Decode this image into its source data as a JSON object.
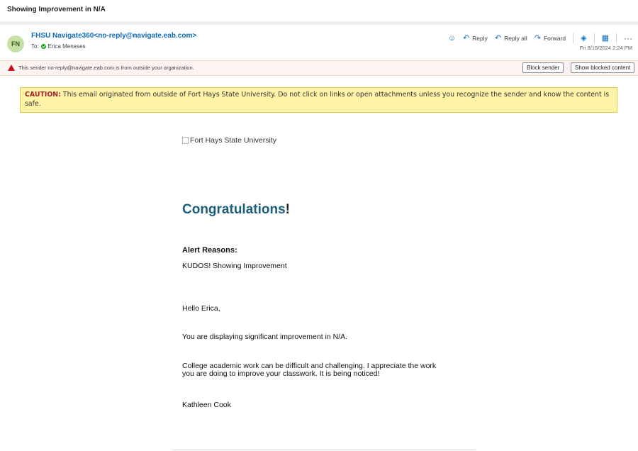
{
  "subject": "Showing Improvement in N/A",
  "message": {
    "avatar_initials": "FN",
    "sender": "FHSU Navigate360<no-reply@navigate.eab.com>",
    "to_label": "To:",
    "to_name": "Erica Meneses",
    "date": "Fri 8/16/2024 2:24 PM",
    "actions": {
      "reply": "Reply",
      "reply_all": "Reply all",
      "forward": "Forward",
      "more": "···"
    }
  },
  "warning": {
    "text": "This sender no-reply@navigate.eab.com is from outside your organization.",
    "block_sender": "Block sender",
    "show_blocked": "Show blocked content"
  },
  "caution": {
    "label": "CAUTION:",
    "text": "This email originated from outside of Fort Hays State University. Do not click on links or open attachments unless you recognize the sender and know the content is safe."
  },
  "body": {
    "logo_alt": "Fort Hays State University",
    "heading": "Congratulations",
    "heading_bang": "!",
    "alert_heading": "Alert Reasons:",
    "alert_reason": "KUDOS! Showing Improvement",
    "greeting": "Hello Erica,",
    "line1": "You are displaying significant improvement in N/A.",
    "line2a": "College academic work can be difficult and challenging. I appreciate the work",
    "line2b": "you are doing to improve your classwork. It is being noticed!",
    "signature": "Kathleen Cook"
  },
  "colors": {
    "link_blue": "#0f6cbd",
    "heading_teal": "#1b5f7e",
    "caution_bg": "#fff3a8",
    "warning_red": "#c50f1f"
  }
}
